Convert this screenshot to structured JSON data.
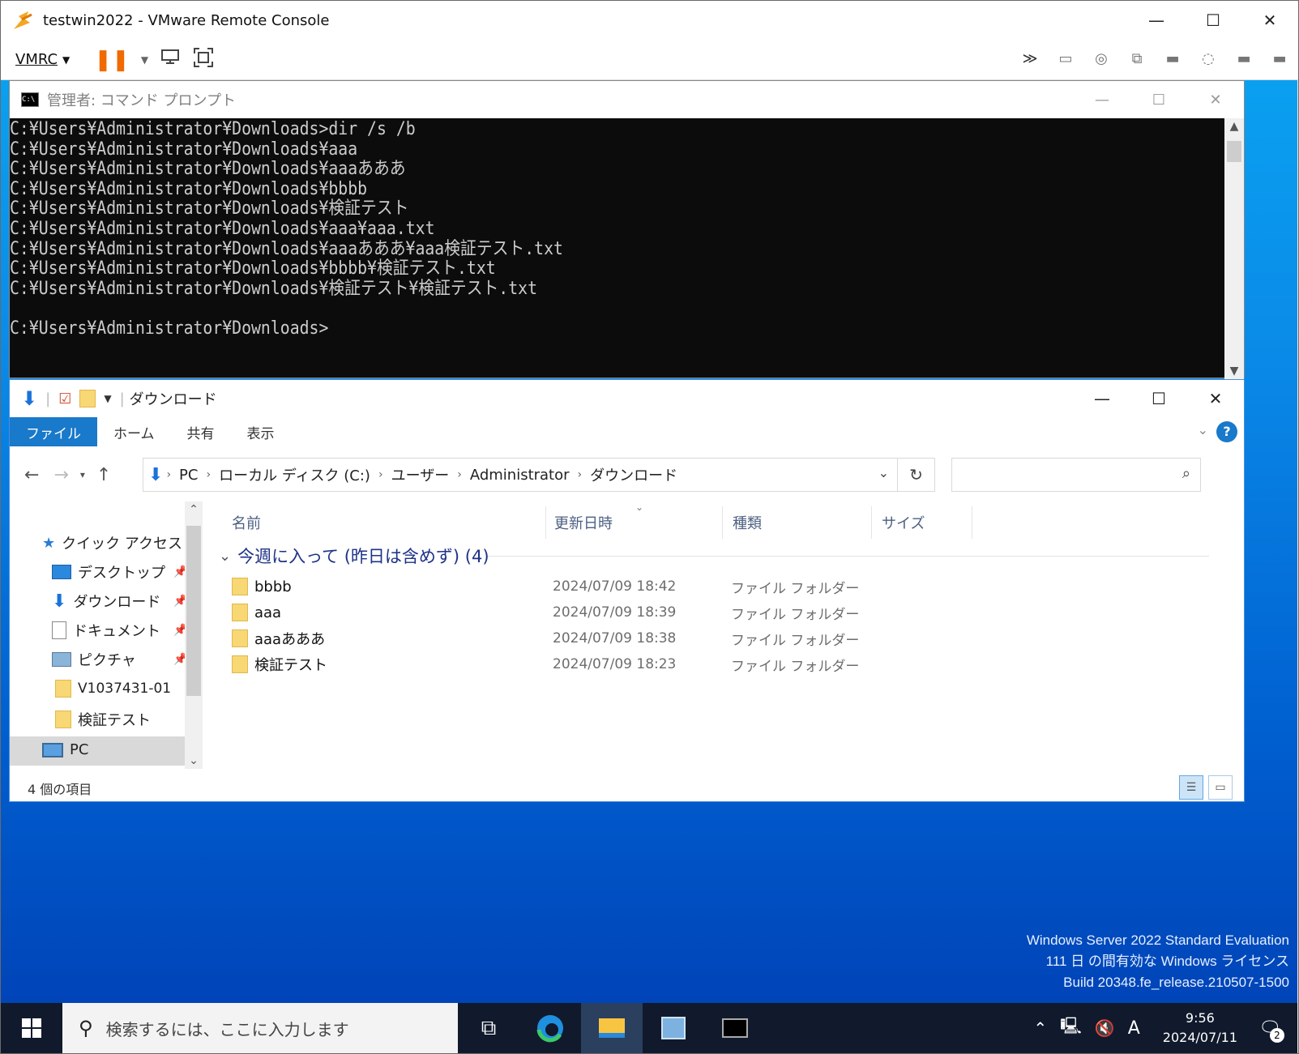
{
  "vmrc": {
    "title": "testwin2022 - VMware Remote Console",
    "menu_label": "VMRC",
    "window_controls": {
      "minimize": "—",
      "maximize": "☐",
      "close": "✕"
    }
  },
  "cmd": {
    "title": "管理者: コマンド プロンプト",
    "icon_text": "C:\\",
    "lines": [
      "C:¥Users¥Administrator¥Downloads>dir /s /b",
      "C:¥Users¥Administrator¥Downloads¥aaa",
      "C:¥Users¥Administrator¥Downloads¥aaaあああ",
      "C:¥Users¥Administrator¥Downloads¥bbbb",
      "C:¥Users¥Administrator¥Downloads¥検証テスト",
      "C:¥Users¥Administrator¥Downloads¥aaa¥aaa.txt",
      "C:¥Users¥Administrator¥Downloads¥aaaあああ¥aaa検証テスト.txt",
      "C:¥Users¥Administrator¥Downloads¥bbbb¥検証テスト.txt",
      "C:¥Users¥Administrator¥Downloads¥検証テスト¥検証テスト.txt",
      "",
      "C:¥Users¥Administrator¥Downloads>"
    ]
  },
  "explorer": {
    "title": "ダウンロード",
    "ribbon_tabs": [
      "ファイル",
      "ホーム",
      "共有",
      "表示"
    ],
    "help_label": "?",
    "breadcrumb": [
      "PC",
      "ローカル ディスク (C:)",
      "ユーザー",
      "Administrator",
      "ダウンロード"
    ],
    "nav": {
      "quick_access": "クイック アクセス",
      "items": [
        {
          "label": "デスクトップ",
          "pinned": true
        },
        {
          "label": "ダウンロード",
          "pinned": true
        },
        {
          "label": "ドキュメント",
          "pinned": true
        },
        {
          "label": "ピクチャ",
          "pinned": true
        },
        {
          "label": "V1037431-01",
          "pinned": false
        },
        {
          "label": "検証テスト",
          "pinned": false
        }
      ],
      "pc": "PC"
    },
    "columns": [
      "名前",
      "更新日時",
      "種類",
      "サイズ"
    ],
    "group_label": "今週に入って (昨日は含めず) (4)",
    "files": [
      {
        "name": "bbbb",
        "date": "2024/07/09 18:42",
        "type": "ファイル フォルダー"
      },
      {
        "name": "aaa",
        "date": "2024/07/09 18:39",
        "type": "ファイル フォルダー"
      },
      {
        "name": "aaaあああ",
        "date": "2024/07/09 18:38",
        "type": "ファイル フォルダー"
      },
      {
        "name": "検証テスト",
        "date": "2024/07/09 18:23",
        "type": "ファイル フォルダー"
      }
    ],
    "status_count": "4 個の項目"
  },
  "watermark": {
    "line1": "Windows Server 2022 Standard Evaluation",
    "line2": "111 日 の間有効な Windows ライセンス",
    "line3": "Build 20348.fe_release.210507-1500"
  },
  "taskbar": {
    "search_placeholder": "検索するには、ここに入力します",
    "ime": "A",
    "time": "9:56",
    "date": "2024/07/11",
    "notification_count": "2"
  },
  "colors": {
    "accent": "#1979ca",
    "taskbar": "#101a2c",
    "folder": "#f8d775",
    "group_header": "#1e3287"
  }
}
